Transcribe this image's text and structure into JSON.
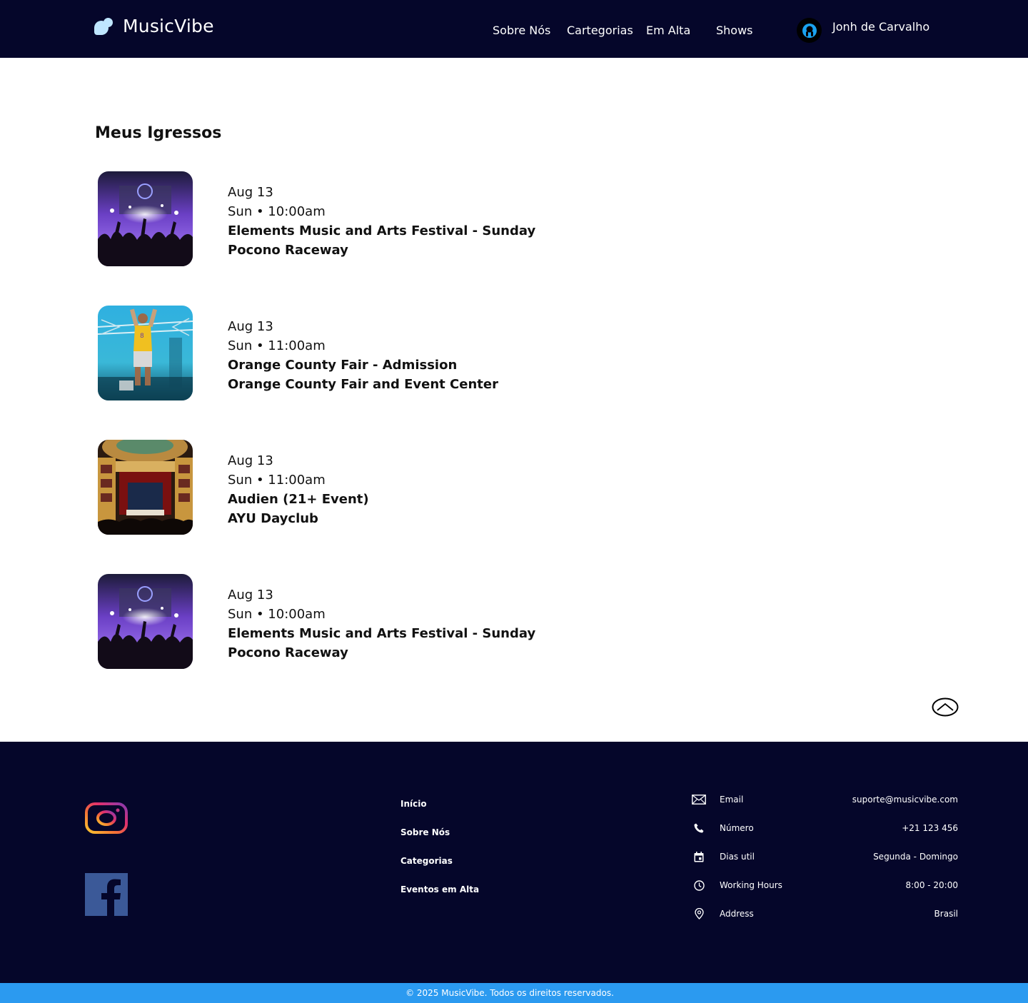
{
  "header": {
    "logo_text": "MusicVibe",
    "nav": [
      "Sobre Nós",
      "Cartegorias",
      "Em Alta",
      "Shows"
    ],
    "user_name": "Jonh de Carvalho"
  },
  "main": {
    "title": "Meus Igressos",
    "tickets": [
      {
        "date": "Aug 13",
        "time": "Sun • 10:00am",
        "event": "Elements Music and Arts Festival - Sunday",
        "venue": "Pocono Raceway",
        "image": "concert-crowd-purple-image"
      },
      {
        "date": "Aug 13",
        "time": "Sun • 11:00am",
        "event": "Orange County Fair - Admission",
        "venue": "Orange County Fair and Event Center",
        "image": "performer-stage-blue-image"
      },
      {
        "date": "Aug 13",
        "time": "Sun • 11:00am",
        "event": "Audien (21+ Event)",
        "venue": "AYU Dayclub",
        "image": "opera-theater-image"
      },
      {
        "date": "Aug 13",
        "time": "Sun • 10:00am",
        "event": "Elements Music and Arts Festival - Sunday",
        "venue": "Pocono Raceway",
        "image": "concert-crowd-purple-image"
      }
    ],
    "scroll_top_icon": "chevron-up-icon"
  },
  "footer": {
    "social": [
      "instagram-icon",
      "facebook-icon"
    ],
    "links": [
      "Início",
      "Sobre Nós",
      "Categorias",
      "Eventos em Alta"
    ],
    "contacts": [
      {
        "icon": "mail-icon",
        "label": "Email",
        "value": "suporte@musicvibe.com"
      },
      {
        "icon": "phone-icon",
        "label": "Número",
        "value": "+21 123 456"
      },
      {
        "icon": "calendar-icon",
        "label": "Dias util",
        "value": "Segunda - Domingo"
      },
      {
        "icon": "clock-icon",
        "label": "Working Hours",
        "value": "8:00 - 20:00"
      },
      {
        "icon": "location-pin-icon",
        "label": "Address",
        "value": "Brasil"
      }
    ],
    "copyright": "© 2025 MusicVibe. Todos os direitos reservados."
  },
  "colors": {
    "navy": "#05062a",
    "accent_blue": "#2b9af0",
    "logo_light": "#bfe6ff"
  }
}
